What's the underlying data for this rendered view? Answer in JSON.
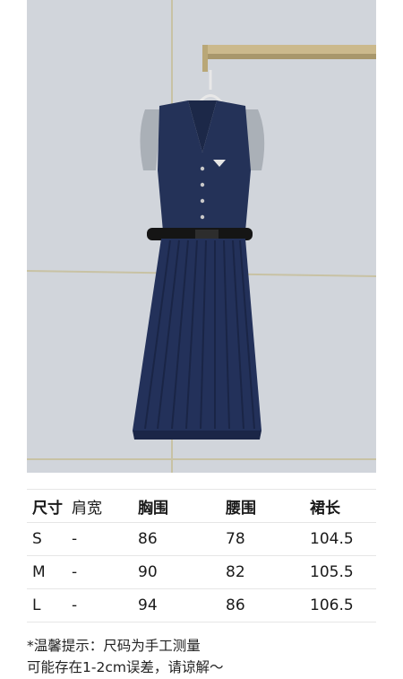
{
  "photo": {
    "description_icon": "dress-photo",
    "colors": {
      "wall": "#d2d6dc",
      "denim": "#1f2b4f",
      "denim_light": "#2e3b63",
      "belt": "#1a1a1a",
      "rail": "#c9b98a"
    }
  },
  "size_table": {
    "headers": {
      "size": "尺寸",
      "shoulder": "肩宽",
      "chest": "胸围",
      "waist": "腰围",
      "length": "裙长"
    },
    "rows": [
      {
        "size": "S",
        "shoulder": "-",
        "chest": "86",
        "waist": "78",
        "length": "104.5"
      },
      {
        "size": "M",
        "shoulder": "-",
        "chest": "90",
        "waist": "82",
        "length": "105.5"
      },
      {
        "size": "L",
        "shoulder": "-",
        "chest": "94",
        "waist": "86",
        "length": "106.5"
      }
    ]
  },
  "note": {
    "line1": "*温馨提示：尺码为手工测量",
    "line2": "可能存在1-2cm误差，请谅解～"
  }
}
